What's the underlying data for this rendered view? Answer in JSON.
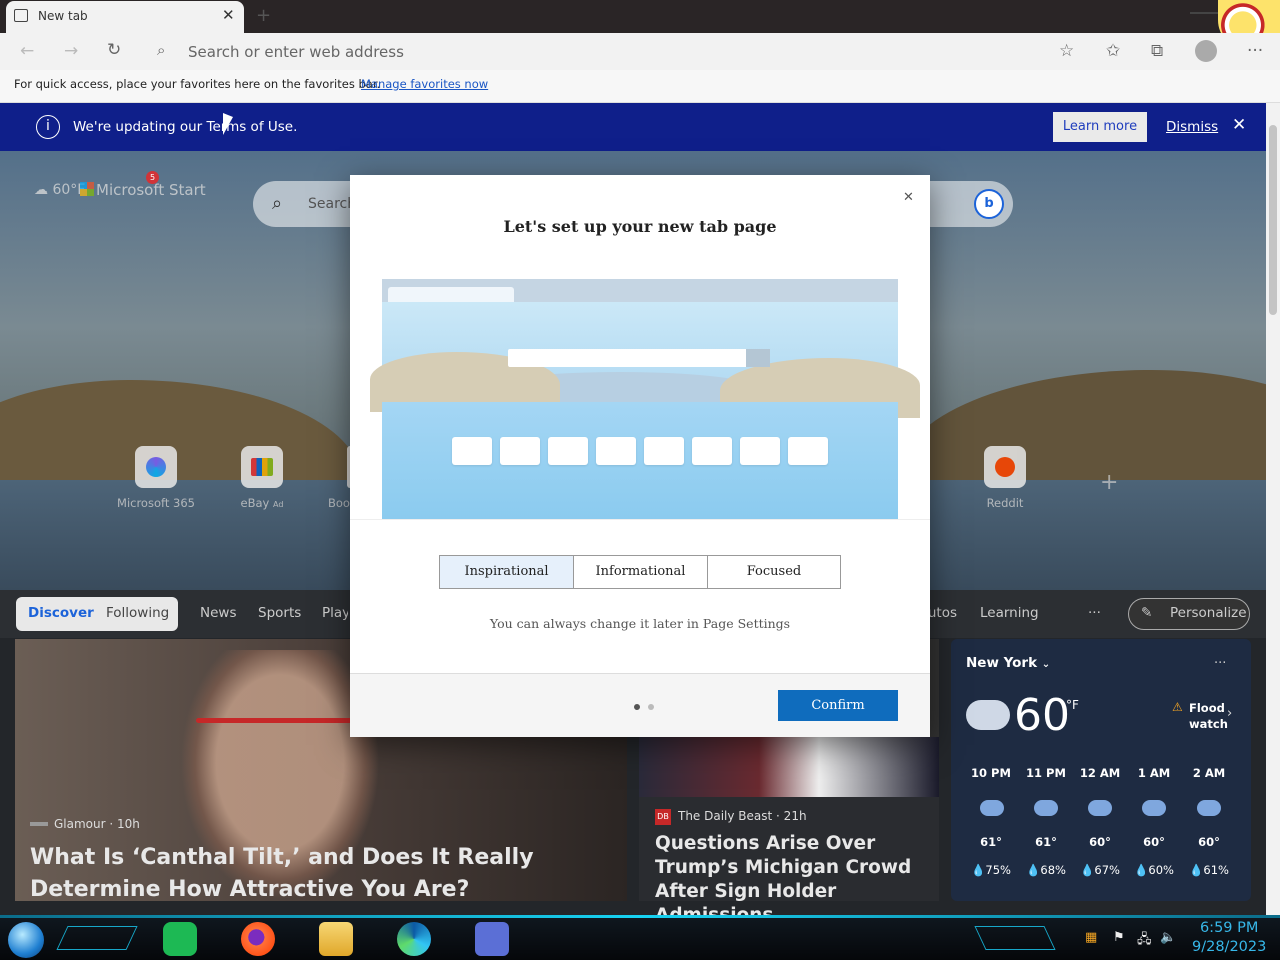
{
  "browser": {
    "tab_title": "New tab",
    "address_placeholder": "Search or enter web address",
    "favbar_hint": "For quick access, place your favorites here on the favorites bar.",
    "favbar_link": "Manage favorites now"
  },
  "banner": {
    "text": "We're updating our Terms of Use.",
    "learn_more": "Learn more",
    "dismiss": "Dismiss"
  },
  "header": {
    "weather_temp": "60°F",
    "brand": "Microsoft Start",
    "notification_count": "5",
    "search_placeholder": "Search"
  },
  "quick_links": [
    {
      "label": "Microsoft 365"
    },
    {
      "label": "eBay",
      "ad": "Ad"
    },
    {
      "label": "Boo"
    },
    {
      "label": "Reddit"
    }
  ],
  "feed_nav": {
    "discover": "Discover",
    "following": "Following",
    "items": [
      "News",
      "Sports",
      "Play",
      "Autos",
      "Learning"
    ],
    "more": "···",
    "personalize": "Personalize"
  },
  "cards": {
    "card1": {
      "source": "Glamour · 10h",
      "title": "What Is ‘Canthal Tilt,’ and Does It Really Determine How Attractive You Are?"
    },
    "card2": {
      "source": "The Daily Beast · 21h",
      "title": "Questions Arise Over Trump’s Michigan Crowd After Sign Holder Admissions"
    }
  },
  "weather": {
    "city": "New York",
    "temp": "60",
    "unit": "°F",
    "alert": "Flood watch",
    "hours": [
      {
        "time": "10 PM",
        "temp": "61°",
        "precip": "75%"
      },
      {
        "time": "11 PM",
        "temp": "61°",
        "precip": "68%"
      },
      {
        "time": "12 AM",
        "temp": "60°",
        "precip": "67%"
      },
      {
        "time": "1 AM",
        "temp": "60°",
        "precip": "60%"
      },
      {
        "time": "2 AM",
        "temp": "60°",
        "precip": "61%"
      }
    ]
  },
  "dialog": {
    "title": "Let's set up your new tab page",
    "options": [
      "Inspirational",
      "Informational",
      "Focused"
    ],
    "selected": "Inspirational",
    "hint": "You can always change it later in Page Settings",
    "confirm": "Confirm"
  },
  "taskbar": {
    "time": "6:59 PM",
    "date": "9/28/2023"
  },
  "colors": {
    "banner_bg": "#0f1f8a",
    "confirm_bg": "#0f6cbd",
    "accent_clock": "#37b7e8"
  }
}
